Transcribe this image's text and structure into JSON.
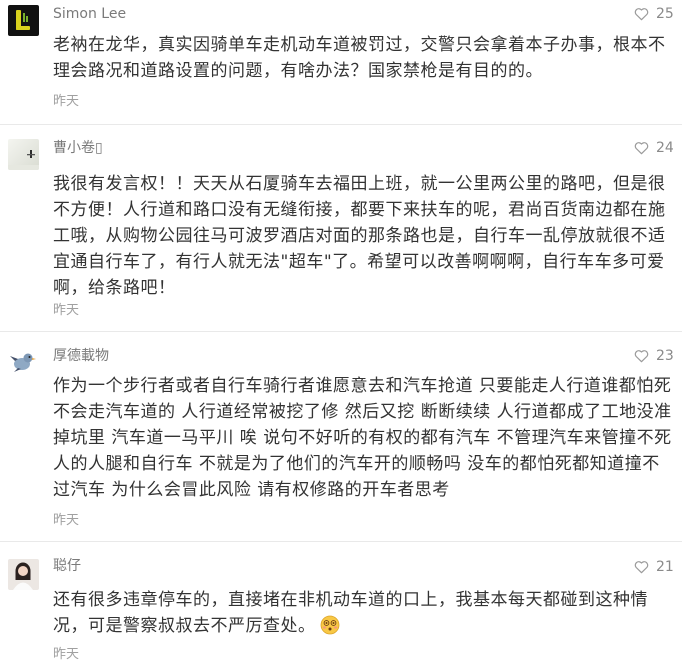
{
  "comments": [
    {
      "author": "Simon Lee",
      "avatar": "logo-avatar",
      "likes": "25",
      "text": "老衲在龙华，真实因骑单车走机动车道被罚过，交警只会拿着本子办事，根本不\n理会路况和道路设置的问题，有啥办法？国家禁枪是有目的的。",
      "time": "昨天"
    },
    {
      "author": "曹小卷▯",
      "avatar": "photo-avatar",
      "likes": "24",
      "text": "我很有发言权！！天天从石厦骑车去福田上班，就一公里两公里的路吧，但是很\n不方便！人行道和路口没有无缝衔接，都要下来扶车的呢，君尚百货南边都在施\n工哦，从购物公园往马可波罗酒店对面的那条路也是，自行车一乱停放就很不适\n宜通自行车了，有行人就无法\"超车\"了。希望可以改善啊啊啊，自行车车多可爱\n啊，给条路吧！",
      "time": "昨天"
    },
    {
      "author": "厚德載物",
      "avatar": "cartoon-bird-avatar",
      "likes": "23",
      "text": "作为一个步行者或者自行车骑行者谁愿意去和汽车抢道 只要能走人行道谁都怕死\n不会走汽车道的 人行道经常被挖了修 然后又挖 断断续续 人行道都成了工地没准\n掉坑里 汽车道一马平川 唉 说句不好听的有权的都有汽车 不管理汽车来管撞不死\n人的人腿和自行车 不就是为了他们的汽车开的顺畅吗 没车的都怕死都知道撞不\n过汽车 为什么会冒此风险 请有权修路的开车者思考",
      "time": "昨天"
    },
    {
      "author": "聪仔",
      "avatar": "girl-photo-avatar",
      "likes": "21",
      "text": "还有很多违章停车的，直接堵在非机动车道的口上，我基本每天都碰到这种情\n况，可是警察叔叔去不严厉查处。",
      "trailing_emoji": "dizzy-face-emoji",
      "time": "昨天"
    }
  ],
  "icons": {
    "like": "heart-outline-icon"
  },
  "colors": {
    "background": "#ffffff",
    "comment_text": "#333333",
    "meta_text": "#999999",
    "divider": "#e9e9e9"
  }
}
